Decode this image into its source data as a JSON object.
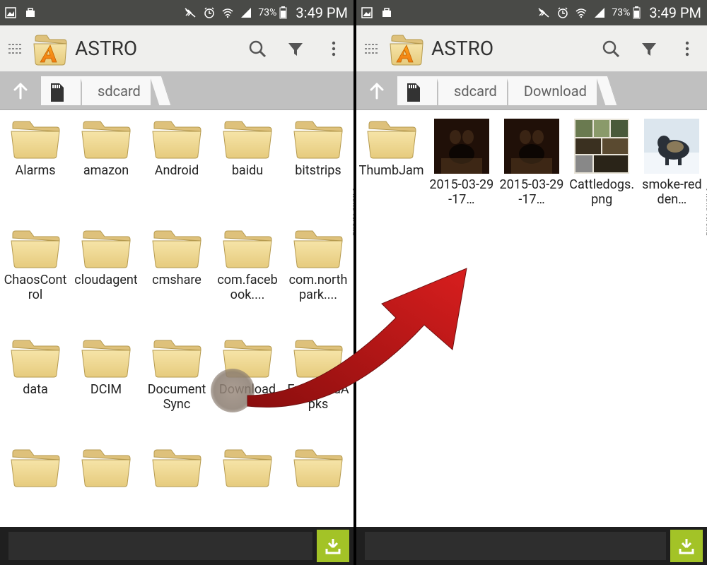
{
  "status": {
    "battery_pct": "73%",
    "time": "3:49 PM"
  },
  "app": {
    "title": "ASTRO"
  },
  "breadcrumb": {
    "left": [
      "sdcard"
    ],
    "right": [
      "sdcard",
      "Download"
    ]
  },
  "left_grid": [
    "Alarms",
    "amazon",
    "Android",
    "baidu",
    "bitstrips",
    "ChaosControl",
    "cloudagent",
    "cmshare",
    "com.facebook....",
    "com.northpark....",
    "data",
    "DCIM",
    "DocumentSync",
    "Download",
    "ExtractedApks",
    "",
    "",
    "",
    "",
    ""
  ],
  "right_grid": [
    {
      "type": "folder",
      "label": "ThumbJam"
    },
    {
      "type": "image",
      "label": "2015-03-29-17…",
      "swatch": "dognose"
    },
    {
      "type": "image",
      "label": "2015-03-29-17…",
      "swatch": "dognose"
    },
    {
      "type": "image",
      "label": "Cattledogs.png",
      "swatch": "collage"
    },
    {
      "type": "image",
      "label": "smoke-redden…",
      "swatch": "snowdog"
    }
  ],
  "watermark": "Phone Arena"
}
